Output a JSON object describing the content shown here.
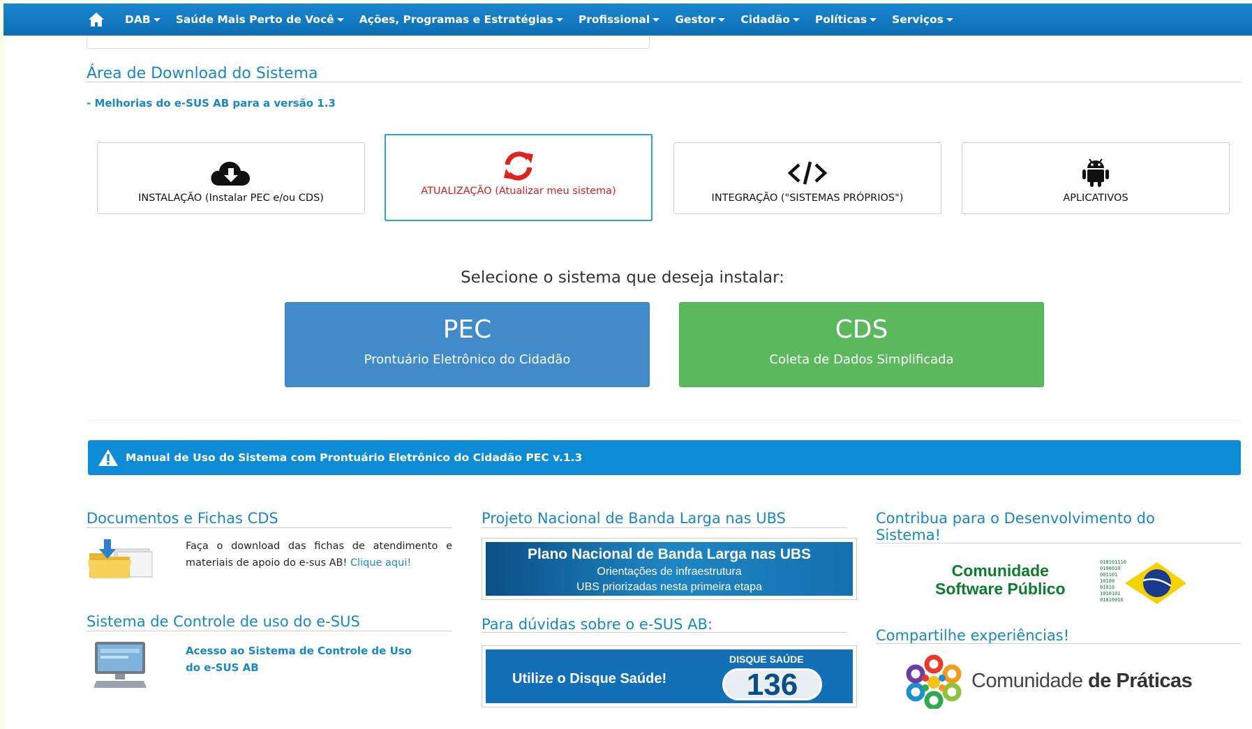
{
  "nav": {
    "home_icon": "home-icon",
    "items": [
      {
        "label": "DAB"
      },
      {
        "label": "Saúde Mais Perto de Você"
      },
      {
        "label": "Ações, Programas e Estratégias"
      },
      {
        "label": "Profissional"
      },
      {
        "label": "Gestor"
      },
      {
        "label": "Cidadão"
      },
      {
        "label": "Políticas"
      },
      {
        "label": "Serviços"
      }
    ]
  },
  "download": {
    "title": "Área de Download do Sistema",
    "improvements_link": "- Melhorias do e-SUS AB para a versão 1.3",
    "cards": [
      {
        "label": "INSTALAÇÃO (Instalar PEC e/ou CDS)",
        "icon": "cloud-download-icon"
      },
      {
        "label": "ATUALIZAÇÃO (Atualizar meu sistema)",
        "icon": "refresh-icon",
        "active": true
      },
      {
        "label": "INTEGRAÇÃO (\"SISTEMAS PRÓPRIOS\")",
        "icon": "code-icon"
      },
      {
        "label": "APLICATIVOS",
        "icon": "android-icon"
      }
    ],
    "select_prompt": "Selecione o sistema que deseja instalar:",
    "pec": {
      "title": "PEC",
      "subtitle": "Prontuário Eletrônico do Cidadão"
    },
    "cds": {
      "title": "CDS",
      "subtitle": "Coleta de Dados Simplificada"
    }
  },
  "manual_bar": {
    "text": "Manual de Uso do Sistema com Prontuário Eletrônico do Cidadão PEC v.1.3",
    "icon": "warning-icon"
  },
  "documents": {
    "title": "Documentos e Fichas CDS",
    "text": "Faça o download das fichas de atendimento e materiais de apoio do e-sus AB!",
    "link": "Clique aqui!"
  },
  "control": {
    "title": "Sistema de Controle de uso do e-SUS",
    "link": "Acesso ao Sistema de Controle de Uso do e-SUS AB"
  },
  "broadband": {
    "title": "Projeto Nacional de Banda Larga nas UBS",
    "banner_title": "Plano Nacional de Banda Larga nas UBS",
    "banner_line1": "Orientações de infraestrutura",
    "banner_line2": "UBS priorizadas nesta primeira etapa"
  },
  "doubts": {
    "title": "Para dúvidas sobre o e-SUS AB:",
    "banner_left": "Utilize o Disque Saúde!",
    "banner_top": "DISQUE SAÚDE",
    "banner_number": "136"
  },
  "contribute": {
    "title": "Contribua para o Desenvolvimento do Sistema!",
    "logo_line1": "Comunidade",
    "logo_line2": "Software Público"
  },
  "share": {
    "title": "Compartilhe experiências!",
    "logo_regular": "Comunidade ",
    "logo_bold": "de Práticas"
  },
  "colors": {
    "nav": "#0d6fb4",
    "link": "#1788c4",
    "pec": "#428bca",
    "cds": "#5cb85c",
    "alert": "#0d8bd4",
    "active_border": "#29a3dc",
    "active_text": "#d0201f"
  }
}
